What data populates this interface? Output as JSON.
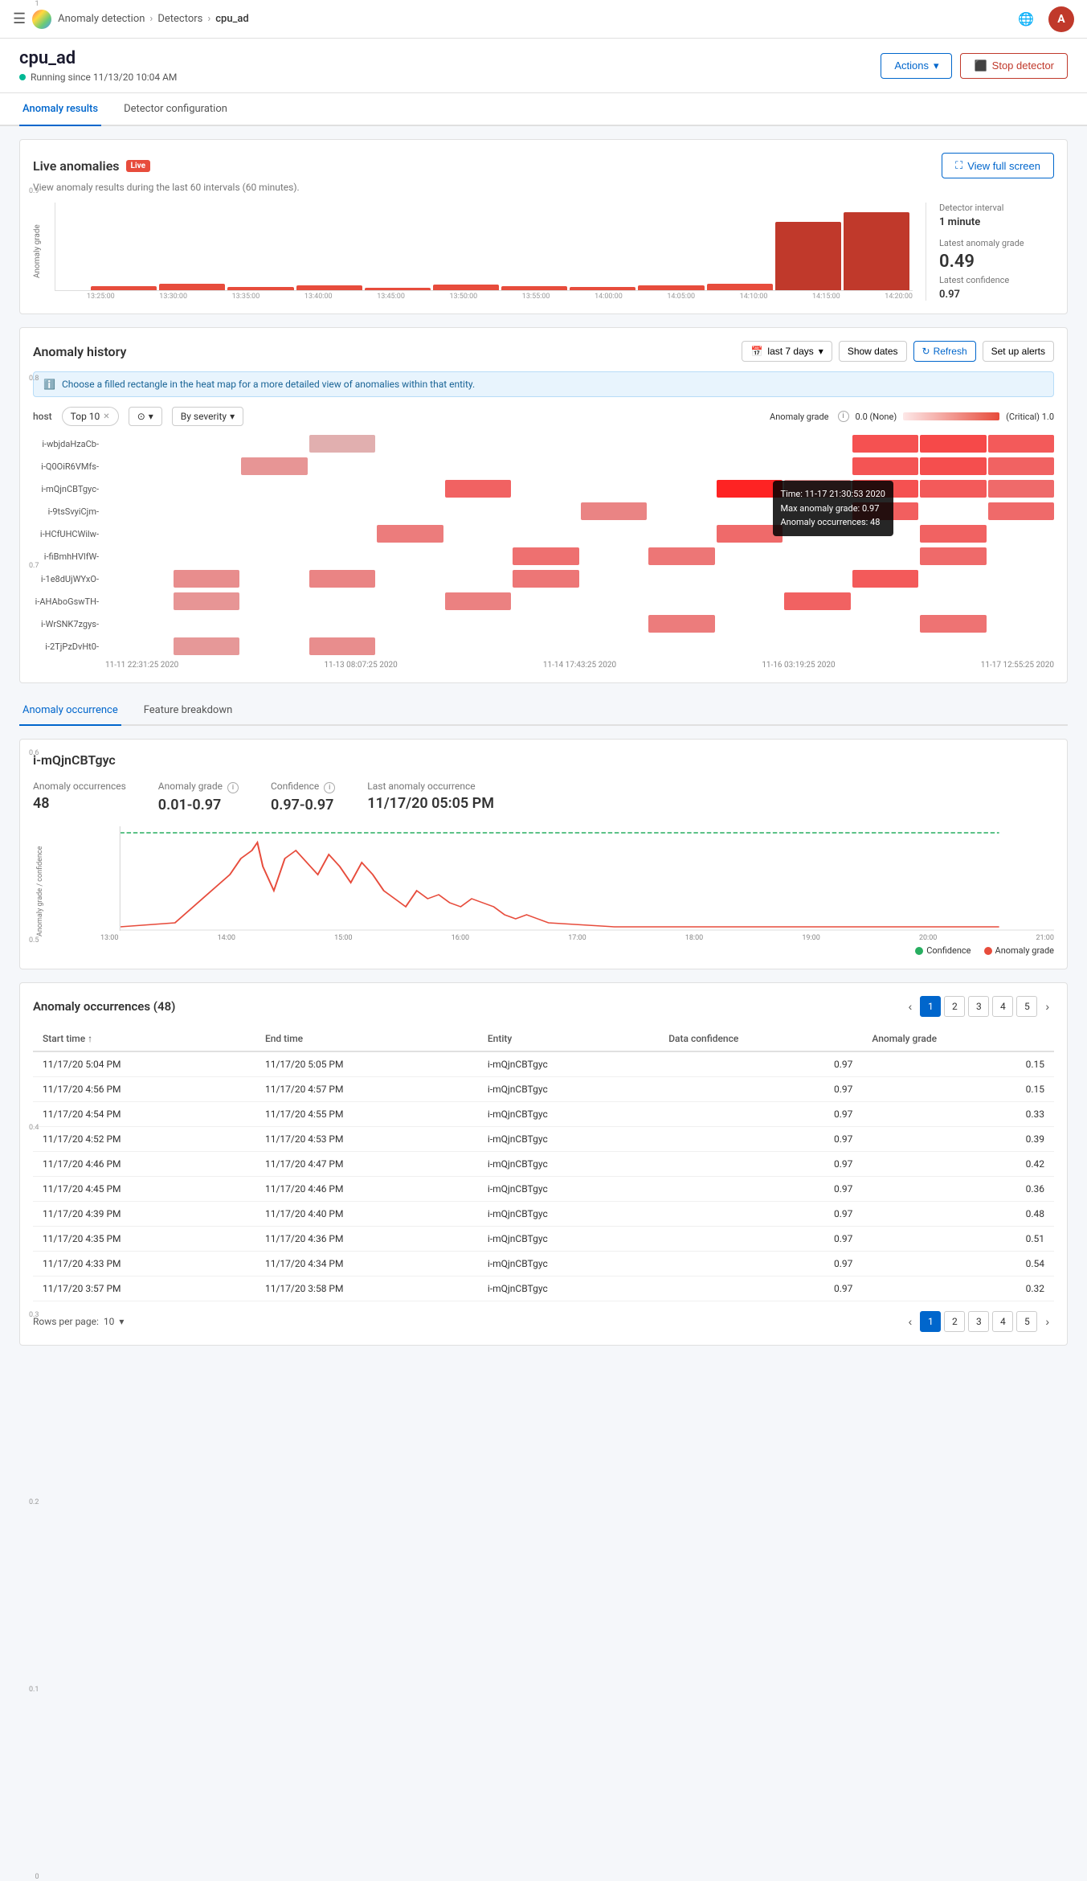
{
  "nav": {
    "menu_icon": "☰",
    "breadcrumb": [
      "Anomaly detection",
      "Detectors",
      "cpu_ad"
    ],
    "right_icon": "🌐"
  },
  "page": {
    "title": "cpu_ad",
    "status": "Running since 11/13/20 10:04 AM",
    "actions_label": "Actions",
    "stop_label": "Stop detector"
  },
  "tabs": [
    "Anomaly results",
    "Detector configuration"
  ],
  "active_tab": 0,
  "live_anomalies": {
    "title": "Live anomalies",
    "badge": "Live",
    "subtitle": "View anomaly results during the last 60 intervals (60 minutes).",
    "view_full_screen": "View full screen",
    "stats": {
      "detector_interval_label": "Detector interval",
      "detector_interval_value": "1 minute",
      "latest_grade_label": "Latest anomaly grade",
      "latest_grade_value": "0.49",
      "latest_conf_label": "Latest confidence",
      "latest_conf_value": "0.97"
    },
    "y_axis_label": "Anomaly grade",
    "x_labels": [
      "13:25:00",
      "13:30:00",
      "13:35:00",
      "13:40:00",
      "13:45:00",
      "13:50:00",
      "13:55:00",
      "14:00:00",
      "14:05:00",
      "14:10:00",
      "14:15:00",
      "14:20:00"
    ],
    "bars": [
      0.05,
      0.08,
      0.04,
      0.06,
      0.03,
      0.07,
      0.05,
      0.04,
      0.06,
      0.08,
      0.85,
      0.97
    ]
  },
  "anomaly_history": {
    "title": "Anomaly history",
    "date_range": "last 7 days",
    "show_dates": "Show dates",
    "refresh": "Refresh",
    "setup_alerts": "Set up alerts",
    "info_text": "Choose a filled rectangle in the heat map for a more detailed view of anomalies within that entity.",
    "controls": {
      "host_label": "host",
      "filter_chip": "Top 10",
      "sort_label": "By severity"
    },
    "grade_legend": {
      "label": "Anomaly grade",
      "min": "0.0 (None)",
      "max": "(Critical) 1.0"
    },
    "rows": [
      {
        "label": "i-wbjdaHzaCb-",
        "cells": [
          0,
          0,
          0,
          0.15,
          0,
          0,
          0,
          0,
          0,
          0,
          0,
          0.7,
          0.75,
          0.65
        ]
      },
      {
        "label": "i-Q0OiR6VMfs-",
        "cells": [
          0,
          0,
          0.3,
          0,
          0,
          0,
          0,
          0,
          0,
          0,
          0,
          0.68,
          0.72,
          0.6
        ]
      },
      {
        "label": "i-mQjnCBTgyc-",
        "cells": [
          0,
          0,
          0,
          0,
          0,
          0.6,
          0,
          0,
          0,
          0.97,
          0.3,
          0.7,
          0.65,
          0.55
        ]
      },
      {
        "label": "i-9tsSvyiCjm-",
        "cells": [
          0,
          0,
          0,
          0,
          0,
          0,
          0,
          0.4,
          0,
          0,
          0,
          0.62,
          0,
          0.55
        ]
      },
      {
        "label": "i-HCfUHCWilw-",
        "cells": [
          0,
          0,
          0,
          0,
          0.45,
          0,
          0,
          0,
          0,
          0.55,
          0,
          0,
          0.6,
          0
        ]
      },
      {
        "label": "i-fiBmhHVlfW-",
        "cells": [
          0,
          0,
          0,
          0,
          0,
          0,
          0.52,
          0,
          0.48,
          0,
          0,
          0,
          0.55,
          0
        ]
      },
      {
        "label": "i-1e8dUjWYxO-",
        "cells": [
          0,
          0.35,
          0,
          0.4,
          0,
          0,
          0.48,
          0,
          0,
          0,
          0,
          0.65,
          0,
          0
        ]
      },
      {
        "label": "i-AHAboGswTH-",
        "cells": [
          0,
          0.3,
          0,
          0,
          0,
          0.42,
          0,
          0,
          0,
          0,
          0.6,
          0,
          0,
          0
        ]
      },
      {
        "label": "i-WrSNK7zgys-",
        "cells": [
          0,
          0,
          0,
          0,
          0,
          0,
          0,
          0,
          0.45,
          0,
          0,
          0,
          0.5,
          0
        ]
      },
      {
        "label": "i-2TjPzDvHt0-",
        "cells": [
          0,
          0.28,
          0,
          0.35,
          0,
          0,
          0,
          0,
          0,
          0,
          0,
          0,
          0,
          0
        ]
      }
    ],
    "x_labels": [
      "11-11 22:31:25 2020",
      "11-13 08:07:25 2020",
      "11-14 17:43:25 2020",
      "11-16 03:19:25 2020",
      "11-17 12:55:25 2020"
    ],
    "tooltip": {
      "time": "Time: 11-17 21:30:53 2020",
      "max_grade": "Max anomaly grade: 0.97",
      "occurrences": "Anomaly occurrences: 48"
    }
  },
  "occurrence_tabs": [
    "Anomaly occurrence",
    "Feature breakdown"
  ],
  "active_occ_tab": 0,
  "entity_detail": {
    "title": "i-mQjnCBTgyc",
    "stats": {
      "occurrences_label": "Anomaly occurrences",
      "occurrences_value": "48",
      "grade_label": "Anomaly grade",
      "grade_value": "0.01-0.97",
      "confidence_label": "Confidence",
      "confidence_value": "0.97-0.97",
      "last_label": "Last anomaly occurrence",
      "last_value": "11/17/20 05:05 PM"
    },
    "y_axis_label": "Anomaly grade / confidence",
    "x_labels": [
      "13:00",
      "14:00",
      "15:00",
      "16:00",
      "17:00",
      "18:00",
      "19:00",
      "20:00",
      "21:00"
    ],
    "legend": {
      "confidence": "Confidence",
      "grade": "Anomaly grade"
    }
  },
  "occurrences_table": {
    "title": "Anomaly occurrences (48)",
    "columns": [
      "Start time",
      "End time",
      "Entity",
      "Data confidence",
      "Anomaly grade"
    ],
    "rows": [
      {
        "start": "11/17/20 5:04 PM",
        "end": "11/17/20 5:05 PM",
        "entity": "i-mQjnCBTgyc",
        "confidence": "0.97",
        "grade": "0.15"
      },
      {
        "start": "11/17/20 4:56 PM",
        "end": "11/17/20 4:57 PM",
        "entity": "i-mQjnCBTgyc",
        "confidence": "0.97",
        "grade": "0.15"
      },
      {
        "start": "11/17/20 4:54 PM",
        "end": "11/17/20 4:55 PM",
        "entity": "i-mQjnCBTgyc",
        "confidence": "0.97",
        "grade": "0.33"
      },
      {
        "start": "11/17/20 4:52 PM",
        "end": "11/17/20 4:53 PM",
        "entity": "i-mQjnCBTgyc",
        "confidence": "0.97",
        "grade": "0.39"
      },
      {
        "start": "11/17/20 4:46 PM",
        "end": "11/17/20 4:47 PM",
        "entity": "i-mQjnCBTgyc",
        "confidence": "0.97",
        "grade": "0.42"
      },
      {
        "start": "11/17/20 4:45 PM",
        "end": "11/17/20 4:46 PM",
        "entity": "i-mQjnCBTgyc",
        "confidence": "0.97",
        "grade": "0.36"
      },
      {
        "start": "11/17/20 4:39 PM",
        "end": "11/17/20 4:40 PM",
        "entity": "i-mQjnCBTgyc",
        "confidence": "0.97",
        "grade": "0.48"
      },
      {
        "start": "11/17/20 4:35 PM",
        "end": "11/17/20 4:36 PM",
        "entity": "i-mQjnCBTgyc",
        "confidence": "0.97",
        "grade": "0.51"
      },
      {
        "start": "11/17/20 4:33 PM",
        "end": "11/17/20 4:34 PM",
        "entity": "i-mQjnCBTgyc",
        "confidence": "0.97",
        "grade": "0.54"
      },
      {
        "start": "11/17/20 3:57 PM",
        "end": "11/17/20 3:58 PM",
        "entity": "i-mQjnCBTgyc",
        "confidence": "0.97",
        "grade": "0.32"
      }
    ],
    "pagination": [
      "1",
      "2",
      "3",
      "4",
      "5"
    ],
    "active_page": "1",
    "rows_per_page_label": "Rows per page:",
    "rows_per_page_value": "10"
  }
}
